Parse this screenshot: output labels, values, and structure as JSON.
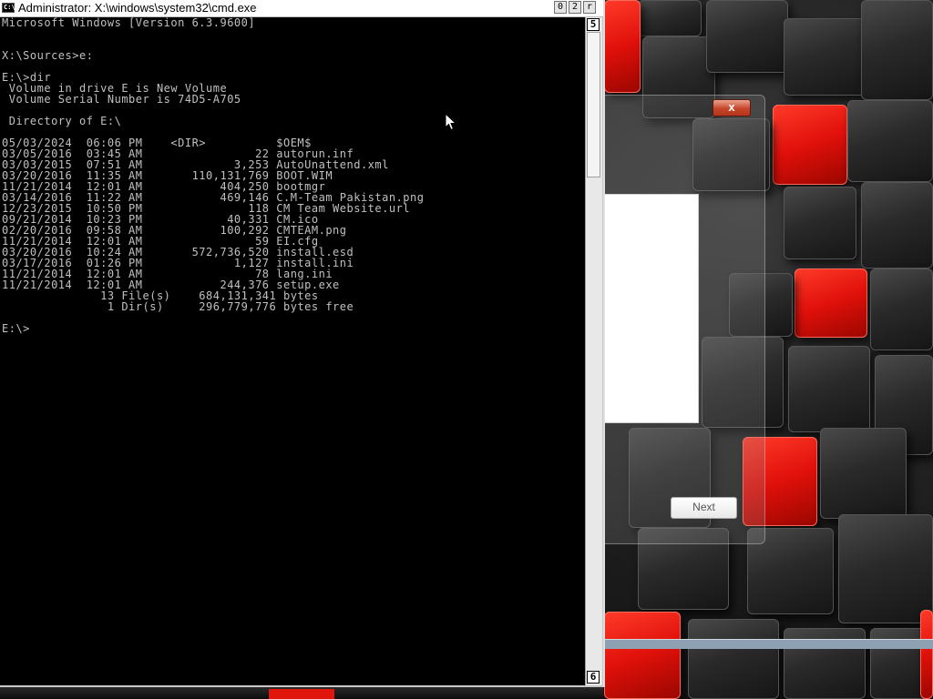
{
  "window": {
    "title": "Administrator: X:\\windows\\system32\\cmd.exe",
    "icon_label": "C:\\",
    "buttons": {
      "minimize": "0",
      "maximize": "2",
      "close": "r"
    }
  },
  "terminal": {
    "lines": [
      "Microsoft Windows [Version 6.3.9600]",
      "",
      "",
      "X:\\Sources>e:",
      "",
      "E:\\>dir",
      " Volume in drive E is New Volume",
      " Volume Serial Number is 74D5-A705",
      "",
      " Directory of E:\\",
      "",
      "05/03/2024  06:06 PM    <DIR>          $OEM$",
      "03/05/2016  03:45 AM                22 autorun.inf",
      "03/03/2015  07:51 AM             3,253 AutoUnattend.xml",
      "03/20/2016  11:35 AM       110,131,769 BOOT.WIM",
      "11/21/2014  12:01 AM           404,250 bootmgr",
      "03/14/2016  11:22 AM           469,146 C.M-Team Pakistan.png",
      "12/23/2015  10:50 PM               118 CM Team Website.url",
      "09/21/2014  10:23 PM            40,331 CM.ico",
      "02/20/2016  09:58 AM           100,292 CMTEAM.png",
      "11/21/2014  12:01 AM                59 EI.cfg",
      "03/20/2016  10:24 AM       572,736,520 install.esd",
      "03/17/2016  01:26 PM             1,127 install.ini",
      "11/21/2014  12:01 AM                78 lang.ini",
      "11/21/2014  12:01 AM           244,376 setup.exe",
      "              13 File(s)    684,131,341 bytes",
      "               1 Dir(s)     296,779,776 bytes free",
      "",
      "E:\\>"
    ]
  },
  "scrollbar": {
    "up_arrow": "5",
    "down_arrow": "6"
  },
  "setup_dialog": {
    "close_label": "x",
    "next_label": "Next"
  },
  "icons": {
    "app": "cmd-icon",
    "close": "close-icon",
    "cursor": "mouse-pointer-icon"
  },
  "colors": {
    "terminal_bg": "#000000",
    "terminal_fg": "#c0c0c0",
    "accent_red": "#e0160d"
  }
}
